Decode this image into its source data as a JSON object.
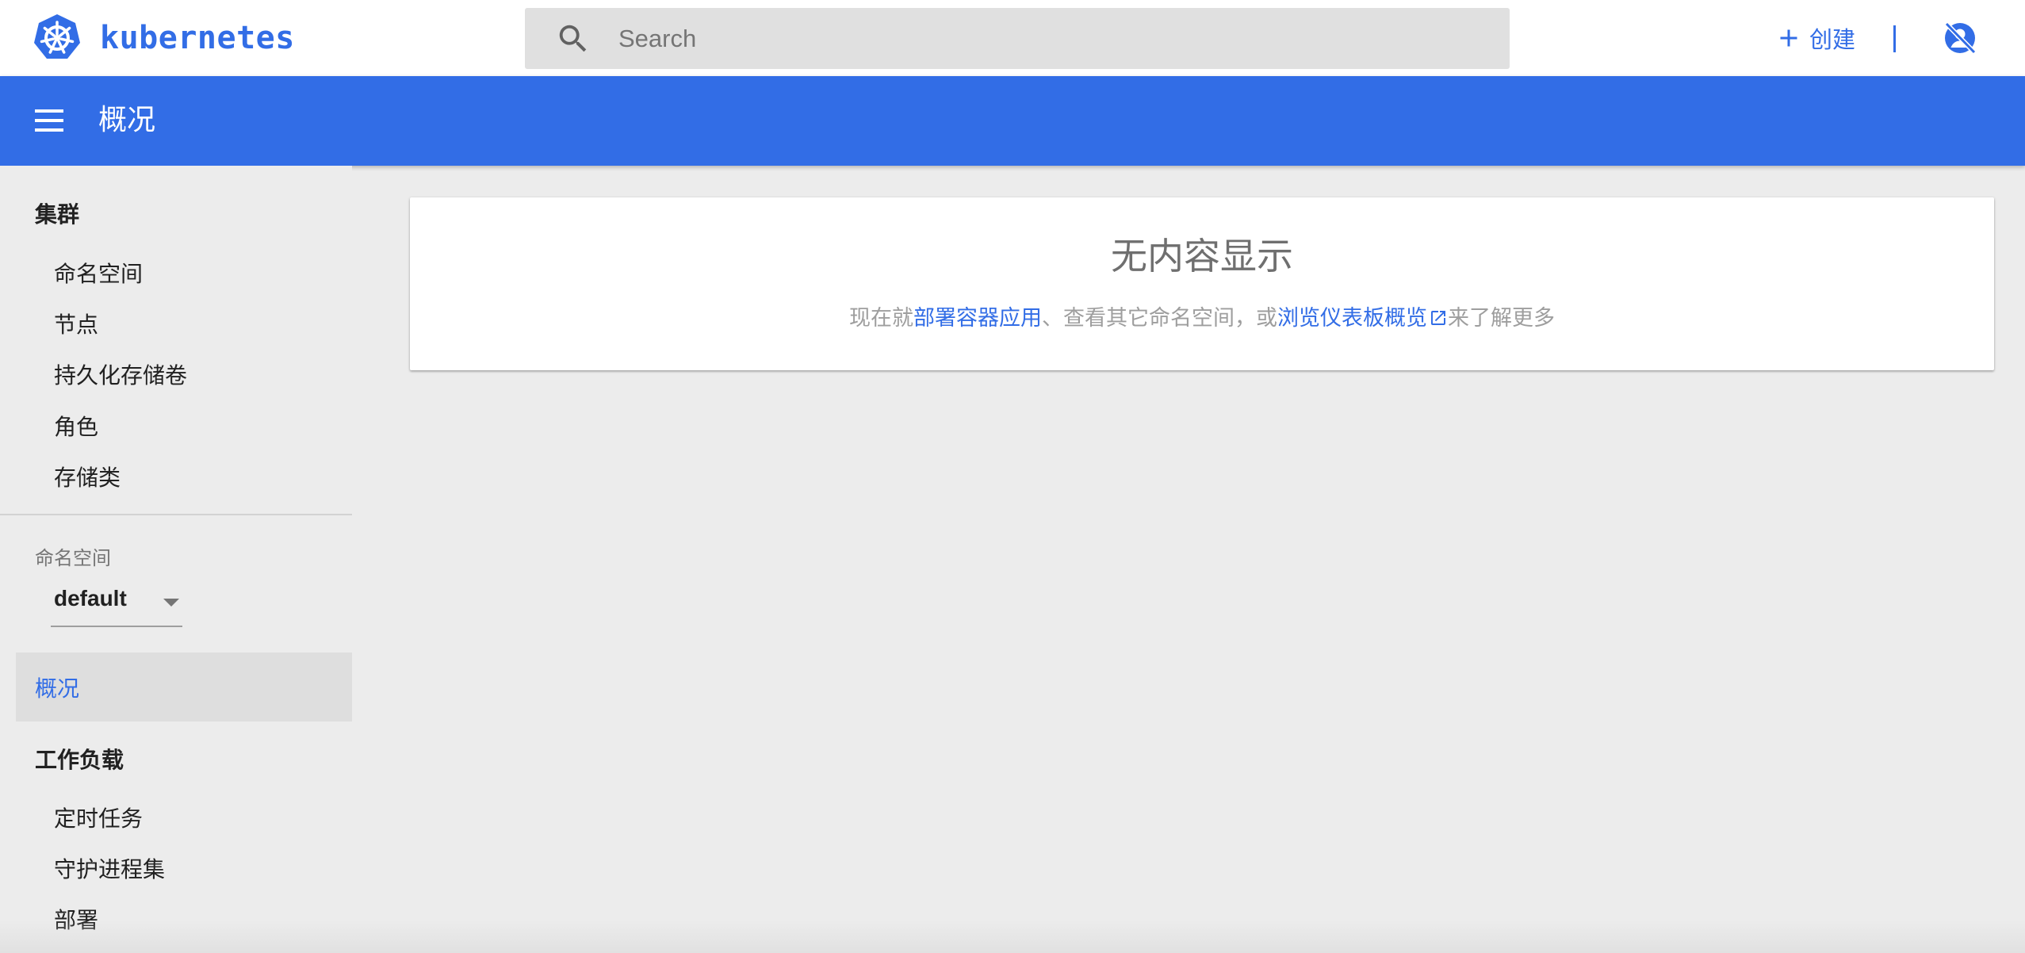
{
  "header": {
    "brand_name": "kubernetes",
    "search_placeholder": "Search",
    "create_label": "创建",
    "accent_color": "#326de6",
    "icons": {
      "logo": "kubernetes-logo",
      "search": "search-icon",
      "create": "plus-icon",
      "account": "account-off-icon"
    }
  },
  "titlebar": {
    "title": "概况",
    "menu_icon": "menu-icon",
    "background_color": "#326de6"
  },
  "sidebar": {
    "cluster": {
      "heading": "集群",
      "items": [
        "命名空间",
        "节点",
        "持久化存储卷",
        "角色",
        "存储类"
      ]
    },
    "namespace": {
      "label": "命名空间",
      "selected": "default"
    },
    "active_item": "概况",
    "workloads": {
      "heading": "工作负载",
      "items": [
        "定时任务",
        "守护进程集",
        "部署"
      ]
    }
  },
  "main": {
    "empty_state": {
      "title": "无内容显示",
      "text_prefix": "现在就",
      "link_deploy": "部署容器应用",
      "text_middle": "、查看其它命名空间，或",
      "link_overview": "浏览仪表板概览",
      "text_suffix": "来了解更多"
    }
  }
}
